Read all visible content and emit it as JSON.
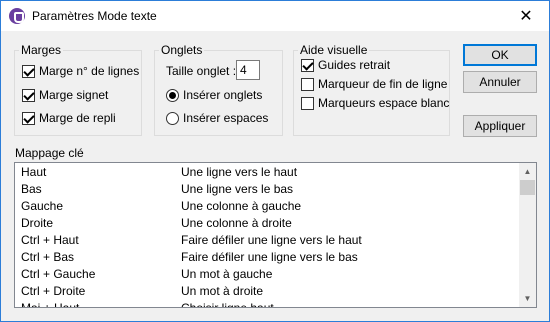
{
  "window": {
    "title": "Paramètres Mode texte",
    "close_symbol": "✕",
    "app_icon": "app-icon"
  },
  "marges": {
    "legend": "Marges",
    "items": [
      {
        "label": "Marge n° de lignes",
        "checked": true
      },
      {
        "label": "Marge signet",
        "checked": true
      },
      {
        "label": "Marge de repli",
        "checked": true
      }
    ]
  },
  "onglets": {
    "legend": "Onglets",
    "tab_size_label": "Taille onglet :",
    "tab_size_value": "4",
    "options": [
      {
        "label": "Insérer onglets",
        "selected": true
      },
      {
        "label": "Insérer espaces",
        "selected": false
      }
    ]
  },
  "aide": {
    "legend": "Aide visuelle",
    "items": [
      {
        "label": "Guides retrait",
        "checked": true
      },
      {
        "label": "Marqueur de fin de ligne",
        "checked": false
      },
      {
        "label": "Marqueurs espace blanc",
        "checked": false
      }
    ]
  },
  "buttons": {
    "ok": "OK",
    "cancel": "Annuler",
    "apply": "Appliquer"
  },
  "key_mapping": {
    "label": "Mappage clé",
    "rows": [
      {
        "key": "Haut",
        "action": "Une ligne vers le haut"
      },
      {
        "key": "Bas",
        "action": "Une ligne vers le bas"
      },
      {
        "key": "Gauche",
        "action": "Une colonne à gauche"
      },
      {
        "key": "Droite",
        "action": "Une colonne à droite"
      },
      {
        "key": "Ctrl + Haut",
        "action": "Faire défiler une ligne vers le haut"
      },
      {
        "key": "Ctrl + Bas",
        "action": "Faire défiler une ligne vers le bas"
      },
      {
        "key": "Ctrl + Gauche",
        "action": "Un mot à gauche"
      },
      {
        "key": "Ctrl + Droite",
        "action": "Un mot à droite"
      },
      {
        "key": "Maj + Haut",
        "action": "Choisir ligne haut"
      }
    ],
    "scroll_up": "▲",
    "scroll_down": "▼"
  }
}
